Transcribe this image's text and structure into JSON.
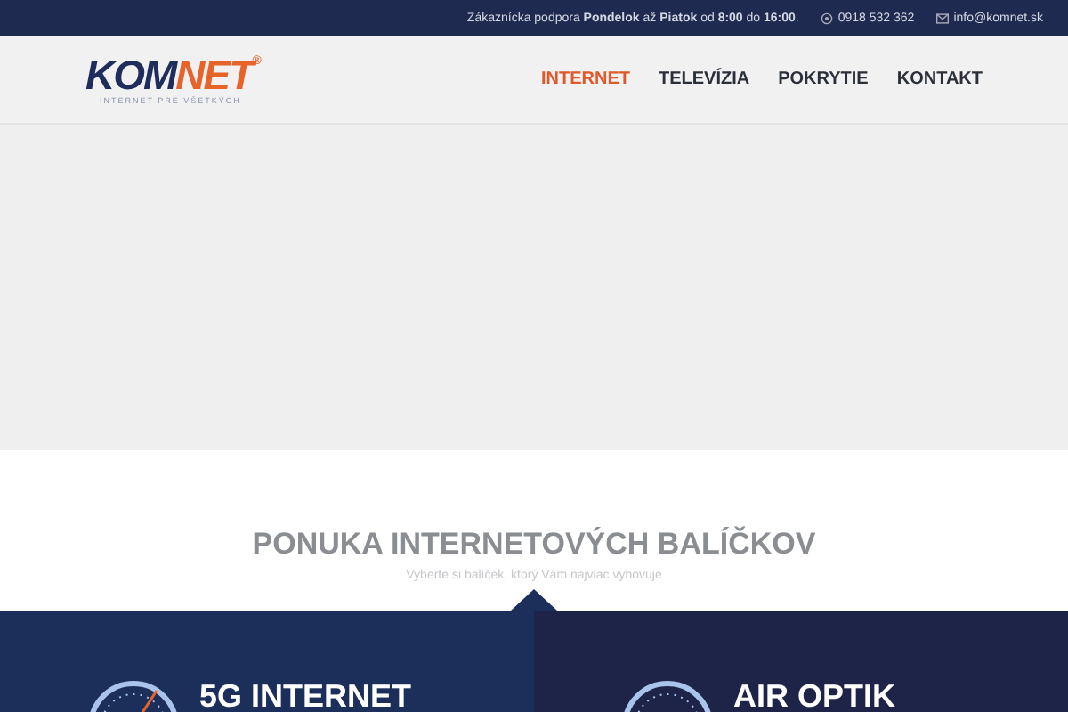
{
  "top_bar": {
    "support": "Zákaznícka podpora **Pondelok** až **Piatok** od **8:00** do **16:00**.",
    "phone": "0918 532 362",
    "email": "info@komnet.sk"
  },
  "logo": {
    "left": "KOM",
    "right": "NET",
    "mark": "®",
    "tagline": "INTERNET PRE VŠETKÝCH"
  },
  "nav": [
    {
      "label": "INTERNET",
      "selected": true
    },
    {
      "label": "TELEVÍZIA",
      "selected": false
    },
    {
      "label": "POKRYTIE",
      "selected": false
    },
    {
      "label": "KONTAKT",
      "selected": false
    }
  ],
  "section": {
    "title": "PONUKA INTERNETOVÝCH BALÍČKOV",
    "subtitle": "Vyberte si balíček, ktorý Vám najviac vyhovuje"
  },
  "packages": [
    {
      "title": "5G INTERNET"
    },
    {
      "title": "AIR OPTIK"
    }
  ]
}
